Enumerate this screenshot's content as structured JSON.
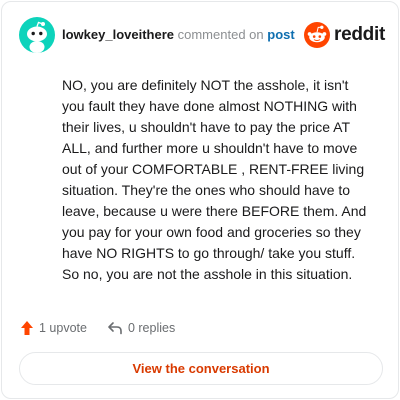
{
  "header": {
    "username": "lowkey_loveithere",
    "action_text": "commented on",
    "link_text": "post",
    "brand_name": "reddit"
  },
  "comment": {
    "text": "NO, you are definitely NOT the asshole, it isn't you fault they have done almost NOTHING with their lives, u shouldn't have to pay the price AT ALL, and further more u shouldn't have to move out of your COMFORTABLE , RENT-FREE living situation. They're the ones who should have to leave, because u were there BEFORE them. And you pay for your own food and groceries so they have NO RIGHTS to go through/ take you stuff. So no, you are not the asshole in this situation."
  },
  "stats": {
    "upvotes_label": "1 upvote",
    "replies_label": "0 replies"
  },
  "cta": {
    "label": "View the conversation"
  },
  "icons": {
    "avatar": "snoo-avatar-icon",
    "brand": "reddit-logo-icon",
    "upvote": "upvote-arrow-icon",
    "reply": "reply-arrow-icon"
  },
  "colors": {
    "avatar_bg": "#0dd3bb",
    "brand_orange": "#ff4500",
    "upvote": "#ff4500",
    "link_blue": "#0f6fb0",
    "cta_text": "#d93a00",
    "border": "#e6e8ea",
    "text": "#1a1a1b",
    "muted": "#8c8f92"
  }
}
